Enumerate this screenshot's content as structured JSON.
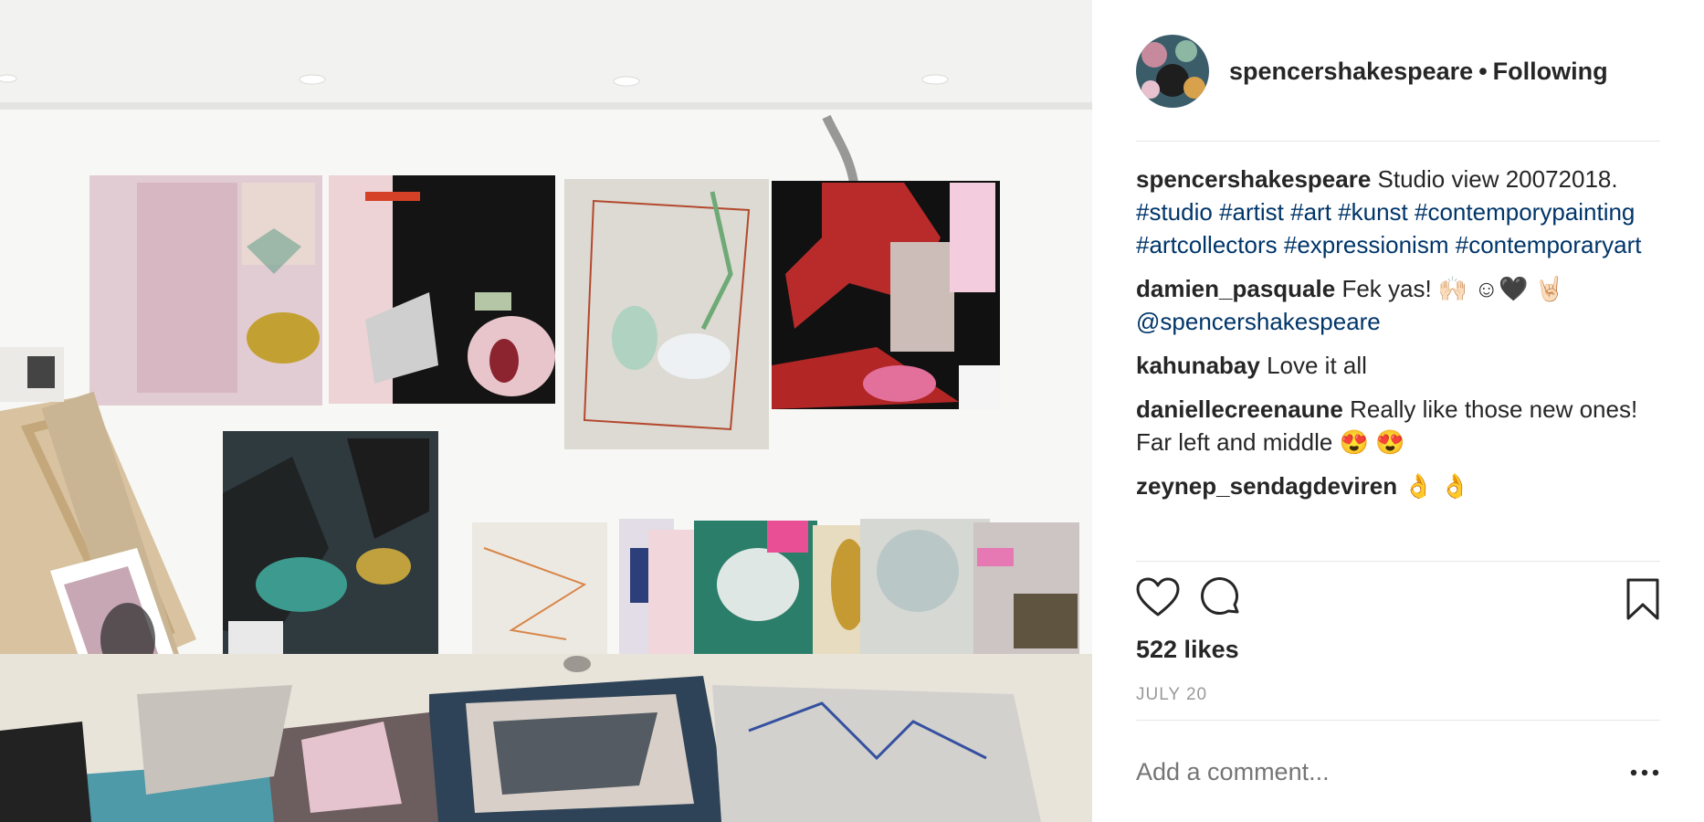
{
  "post": {
    "username": "spencershakespeare",
    "dot": "•",
    "follow_status": "Following",
    "likes": "522 likes",
    "date": "JULY 20",
    "add_comment_placeholder": "Add a comment..."
  },
  "comments": [
    {
      "user": "spencershakespeare",
      "text": "Studio view 20072018.",
      "tags": [
        "#studio",
        "#artist",
        "#art",
        "#kunst",
        "#contemporypainting",
        "#artcollectors",
        "#expressionism",
        "#contemporaryart"
      ]
    },
    {
      "user": "damien_pasquale",
      "text": "Fek yas! 🙌🏻 ☺🖤 🤘🏻",
      "mention": "@spencershakespeare"
    },
    {
      "user": "kahunabay",
      "text": "Love it all"
    },
    {
      "user": "daniellecreenaune",
      "text": "Really like those new ones! Far left and middle 😍 😍"
    },
    {
      "user": "zeynep_sendagdeviren",
      "text": "👌 👌"
    }
  ],
  "icons": {
    "like": "heart-icon",
    "comment": "comment-bubble-icon",
    "save": "bookmark-icon",
    "more": "more-options-icon"
  },
  "colors": {
    "text": "#262626",
    "link": "#003569",
    "muted": "#999999",
    "divider": "#e6e6e6"
  }
}
